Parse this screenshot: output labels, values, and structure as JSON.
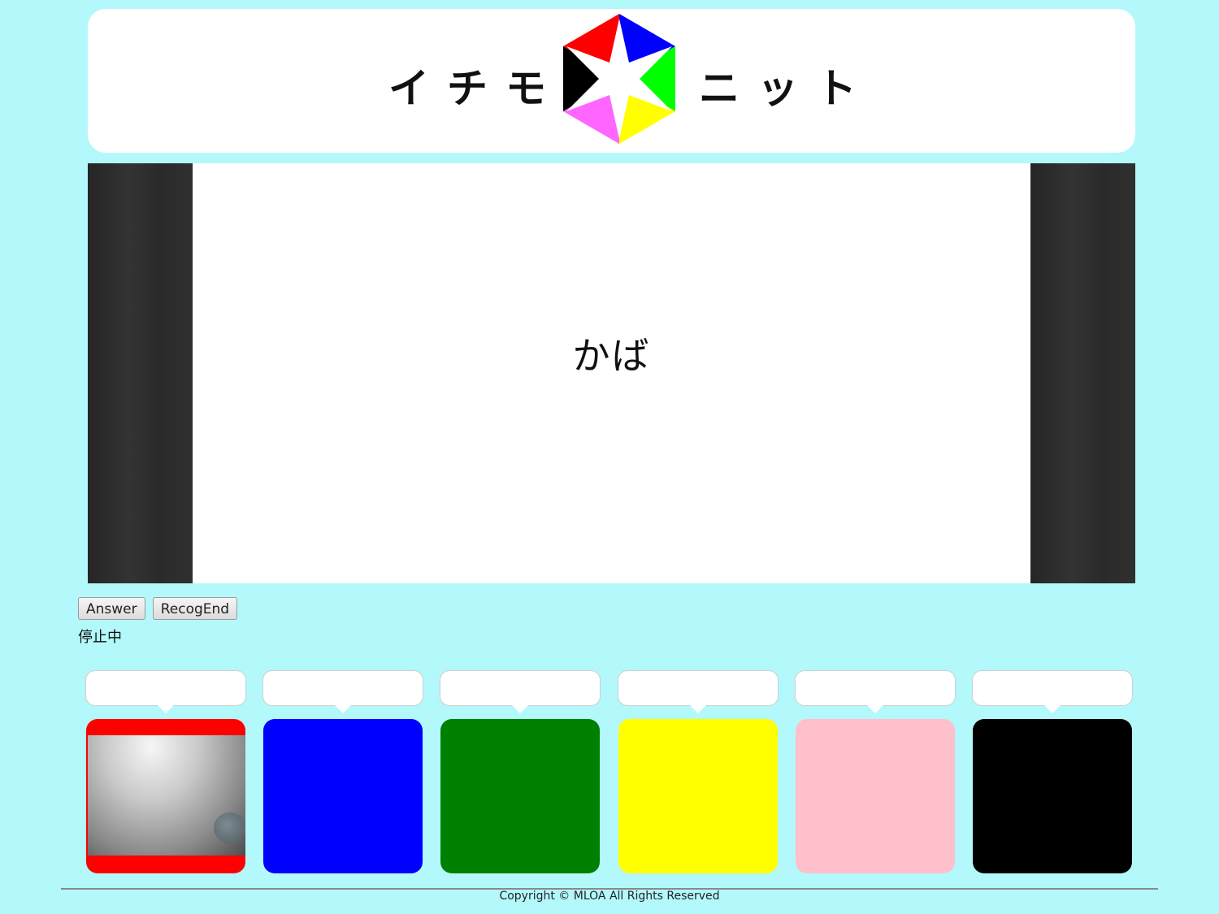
{
  "header": {
    "title_left": "イチモ",
    "title_right": "ニット",
    "logo": "star-hexagon-logo"
  },
  "board": {
    "question": "かば"
  },
  "controls": {
    "answer_label": "Answer",
    "recog_end_label": "RecogEnd",
    "status": "停止中"
  },
  "players": [
    {
      "color": "#ff0000",
      "bubble_text": "",
      "has_camera": true
    },
    {
      "color": "#0000ff",
      "bubble_text": "",
      "has_camera": false
    },
    {
      "color": "#008000",
      "bubble_text": "",
      "has_camera": false
    },
    {
      "color": "#ffff00",
      "bubble_text": "",
      "has_camera": false
    },
    {
      "color": "#ffc0cb",
      "bubble_text": "",
      "has_camera": false
    },
    {
      "color": "#000000",
      "bubble_text": "",
      "has_camera": false
    }
  ],
  "footer": {
    "copyright": "Copyright © MLOA All Rights Reserved"
  },
  "colors": {
    "background": "#b3f8fb",
    "panel": "#ffffff",
    "chalkboard": "#2c2c2c"
  }
}
